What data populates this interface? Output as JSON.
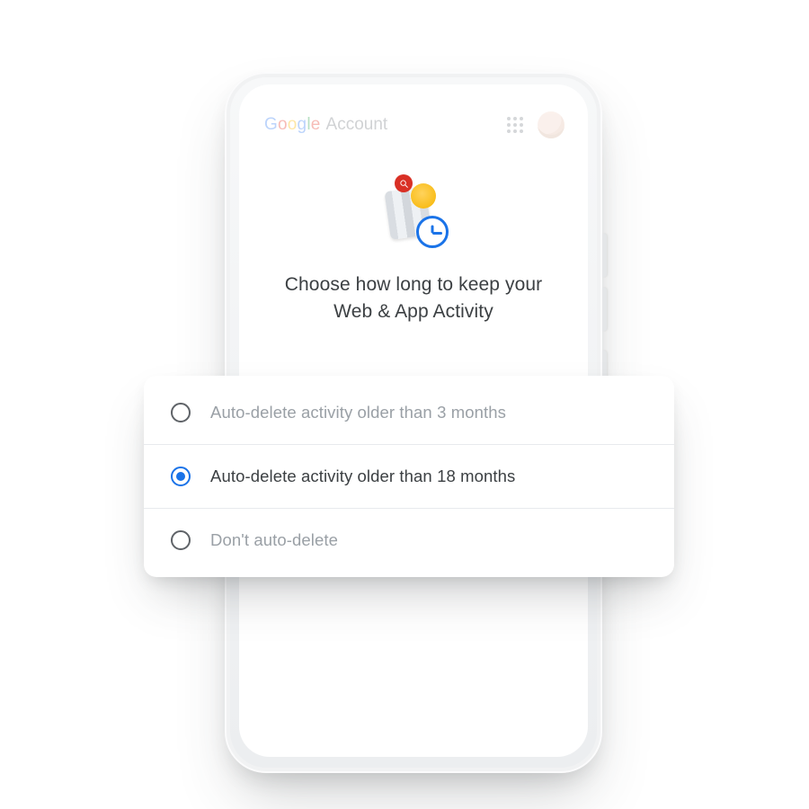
{
  "header": {
    "brand_word": "Google",
    "brand_colors": [
      "#4285F4",
      "#EA4335",
      "#FBBC05",
      "#4285F4",
      "#34A853",
      "#EA4335"
    ],
    "account_label": "Account",
    "apps_icon": "apps-grid-icon",
    "avatar_icon": "user-avatar"
  },
  "hero": {
    "title": "Choose how long to keep your Web & App Activity",
    "icons": {
      "book": "book-stack-icon",
      "coin": "coin-icon",
      "search_badge": "search-icon",
      "clock": "clock-icon"
    }
  },
  "options": [
    {
      "id": "3mo",
      "label": "Auto-delete activity older than 3 months",
      "selected": false
    },
    {
      "id": "18mo",
      "label": "Auto-delete activity older than 18 months",
      "selected": true
    },
    {
      "id": "none",
      "label": "Don't auto-delete",
      "selected": false
    }
  ],
  "colors": {
    "accent": "#1a73e8",
    "text_primary": "#3c4043",
    "text_muted": "#9aa0a6"
  }
}
